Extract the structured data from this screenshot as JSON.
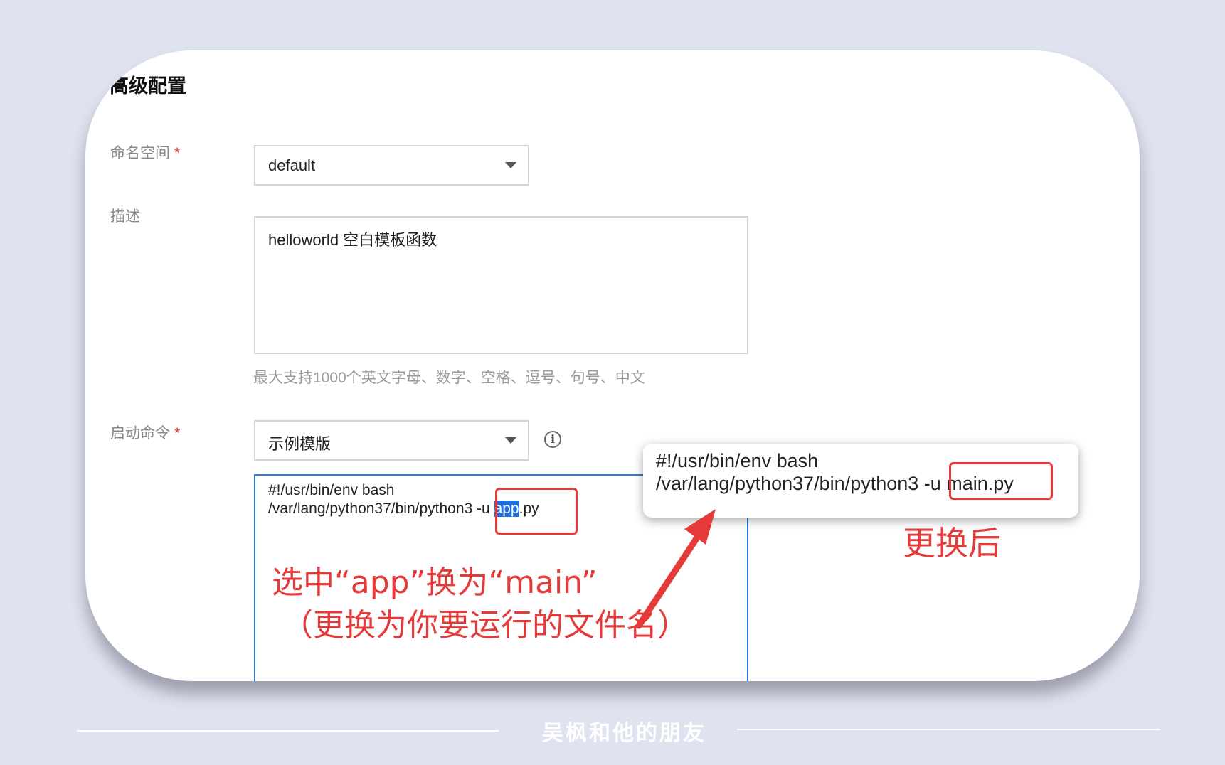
{
  "section": {
    "title": "高级配置"
  },
  "namespace": {
    "label": "命名空间",
    "required_mark": "*",
    "value": "default"
  },
  "description": {
    "label": "描述",
    "value": "helloworld 空白模板函数",
    "hint": "最大支持1000个英文字母、数字、空格、逗号、句号、中文"
  },
  "startup": {
    "label": "启动命令",
    "required_mark": "*",
    "template_value": "示例模版",
    "code_line1": "#!/usr/bin/env bash",
    "code_line2_prefix": "/var/lang/python37/bin/python3 -u ",
    "code_line2_selected": "app",
    "code_line2_suffix": ".py"
  },
  "popup": {
    "code_line1": "#!/usr/bin/env bash",
    "code_line2_prefix": "/var/lang/python37/bin/python3 -",
    "code_line2_highlight": "u main.py"
  },
  "annotations": {
    "after_label": "更换后",
    "instruction_line1": "选中“app”换为“main”",
    "instruction_line2": "（更换为你要运行的文件名）"
  },
  "footer": {
    "text": "吴枫和他的朋友"
  },
  "colors": {
    "accent_red": "#e53a3a",
    "selection_blue": "#1d6fe0",
    "background": "#dfe2ef"
  },
  "icons": {
    "dropdown": "caret-down-icon",
    "info": "info-icon",
    "arrow": "red-arrow-icon"
  }
}
